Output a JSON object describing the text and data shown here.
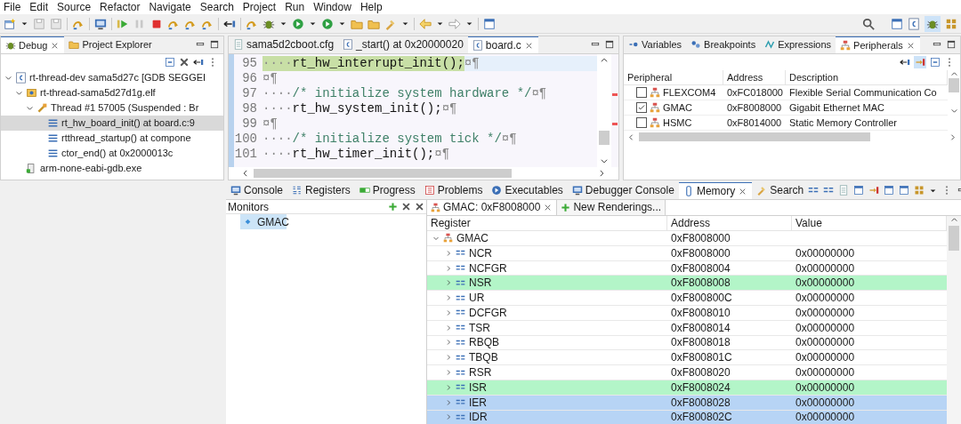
{
  "menu": [
    "File",
    "Edit",
    "Source",
    "Refactor",
    "Navigate",
    "Search",
    "Project",
    "Run",
    "Window",
    "Help"
  ],
  "debug_view": {
    "tabs": [
      {
        "label": "Debug",
        "selected": true
      },
      {
        "label": "Project Explorer",
        "selected": false
      }
    ],
    "tree": [
      {
        "label": "rt-thread-dev sama5d27c [GDB SEGGEI",
        "kind": "launch",
        "expanded": true,
        "selected": false,
        "children": [
          {
            "label": "rt-thread-sama5d27d1g.elf",
            "kind": "process",
            "expanded": true,
            "selected": false,
            "children": [
              {
                "label": "Thread #1 57005 (Suspended : Br",
                "kind": "thread",
                "expanded": true,
                "selected": false,
                "children": [
                  {
                    "label": "rt_hw_board_init() at board.c:9",
                    "kind": "frame",
                    "selected": true
                  },
                  {
                    "label": "rtthread_startup() at compone",
                    "kind": "frame",
                    "selected": false
                  },
                  {
                    "label": "ctor_end() at 0x2000013c",
                    "kind": "frame",
                    "selected": false
                  }
                ]
              }
            ]
          },
          {
            "label": "arm-none-eabi-gdb.exe",
            "kind": "gdb",
            "selected": false
          }
        ]
      }
    ]
  },
  "editor": {
    "tabs": [
      {
        "label": "sama5d2cboot.cfg",
        "kind": "file",
        "selected": false
      },
      {
        "label": "_start() at 0x20000020",
        "kind": "c",
        "selected": false
      },
      {
        "label": "board.c",
        "kind": "c",
        "selected": true
      }
    ],
    "lines": [
      {
        "number": "95",
        "indent": "····",
        "text": "rt_hw_interrupt_init();",
        "kind": "code",
        "current": true
      },
      {
        "number": "96",
        "kind": "blank",
        "current": false
      },
      {
        "number": "97",
        "indent": "····",
        "text": "/* initialize system hardware */",
        "kind": "comment",
        "current": false
      },
      {
        "number": "98",
        "indent": "····",
        "text": "rt_hw_system_init();",
        "kind": "code",
        "current": false
      },
      {
        "number": "99",
        "kind": "blank",
        "current": false
      },
      {
        "number": "100",
        "indent": "····",
        "text": "/* initialize system tick */",
        "kind": "comment",
        "current": false
      },
      {
        "number": "101",
        "indent": "····",
        "text": "rt_hw_timer_init();",
        "kind": "code",
        "current": false
      }
    ],
    "eol_mark": "¤¶"
  },
  "peripherals_view": {
    "tabs": [
      {
        "label": "Variables",
        "selected": false
      },
      {
        "label": "Breakpoints",
        "selected": false
      },
      {
        "label": "Expressions",
        "selected": false
      },
      {
        "label": "Peripherals",
        "selected": true
      }
    ],
    "columns": [
      "Peripheral",
      "Address",
      "Description"
    ],
    "rows": [
      {
        "name": "FLEXCOM4",
        "address": "0xFC018000",
        "description": "Flexible Serial Communication Co",
        "checked": false
      },
      {
        "name": "GMAC",
        "address": "0xF8008000",
        "description": "Gigabit Ethernet MAC",
        "checked": true
      },
      {
        "name": "HSMC",
        "address": "0xF8014000",
        "description": "Static Memory Controller",
        "checked": false
      }
    ]
  },
  "bottom_tabs": [
    {
      "label": "Console",
      "selected": false
    },
    {
      "label": "Registers",
      "selected": false
    },
    {
      "label": "Progress",
      "selected": false
    },
    {
      "label": "Problems",
      "selected": false
    },
    {
      "label": "Executables",
      "selected": false
    },
    {
      "label": "Debugger Console",
      "selected": false
    },
    {
      "label": "Memory",
      "selected": true
    },
    {
      "label": "Search",
      "selected": false
    }
  ],
  "monitors": {
    "title": "Monitors",
    "items": [
      {
        "label": "GMAC",
        "selected": true
      }
    ]
  },
  "renderings": {
    "tabs": [
      {
        "label": "GMAC: 0xF8008000",
        "selected": true
      },
      {
        "label": "New Renderings...",
        "selected": false
      }
    ],
    "columns": [
      "Register",
      "Address",
      "Value"
    ],
    "group": {
      "name": "GMAC",
      "address": "0xF8008000",
      "expanded": true
    },
    "rows": [
      {
        "name": "NCR",
        "address": "0xF8008000",
        "value": "0x00000000",
        "changed": false,
        "selected": false
      },
      {
        "name": "NCFGR",
        "address": "0xF8008004",
        "value": "0x00000000",
        "changed": false,
        "selected": false
      },
      {
        "name": "NSR",
        "address": "0xF8008008",
        "value": "0x00000000",
        "changed": true,
        "selected": false
      },
      {
        "name": "UR",
        "address": "0xF800800C",
        "value": "0x00000000",
        "changed": false,
        "selected": false
      },
      {
        "name": "DCFGR",
        "address": "0xF8008010",
        "value": "0x00000000",
        "changed": false,
        "selected": false
      },
      {
        "name": "TSR",
        "address": "0xF8008014",
        "value": "0x00000000",
        "changed": false,
        "selected": false
      },
      {
        "name": "RBQB",
        "address": "0xF8008018",
        "value": "0x00000000",
        "changed": false,
        "selected": false
      },
      {
        "name": "TBQB",
        "address": "0xF800801C",
        "value": "0x00000000",
        "changed": false,
        "selected": false
      },
      {
        "name": "RSR",
        "address": "0xF8008020",
        "value": "0x00000000",
        "changed": false,
        "selected": false
      },
      {
        "name": "ISR",
        "address": "0xF8008024",
        "value": "0x00000000",
        "changed": true,
        "selected": false
      },
      {
        "name": "IER",
        "address": "0xF8008028",
        "value": "0x00000000",
        "changed": false,
        "selected": true
      },
      {
        "name": "IDR",
        "address": "0xF800802C",
        "value": "0x00000000",
        "changed": false,
        "selected": true
      }
    ]
  }
}
